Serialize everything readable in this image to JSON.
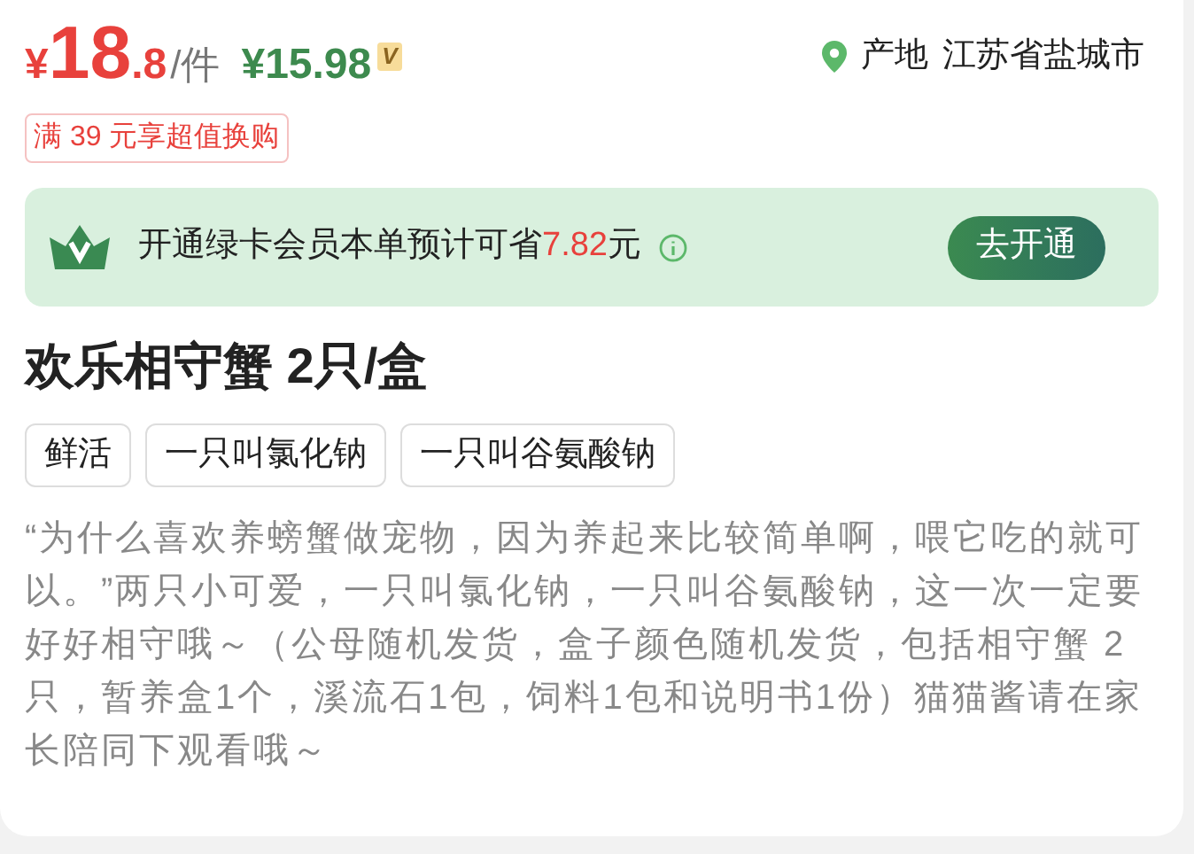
{
  "price": {
    "currency": "¥",
    "integer": "18",
    "decimal": ".8",
    "unit": "/件",
    "member_price": "¥15.98",
    "member_badge": "V"
  },
  "origin": {
    "label": "产地",
    "value": "江苏省盐城市"
  },
  "promo_tag": "满 39 元享超值换购",
  "membership_banner": {
    "text": "开通绿卡会员本单预计可省",
    "amount": "7.82",
    "suffix": "元",
    "button": "去开通"
  },
  "title": "欢乐相守蟹 2只/盒",
  "tags": [
    "鲜活",
    "一只叫氯化钠",
    "一只叫谷氨酸钠"
  ],
  "description": "“为什么喜欢养螃蟹做宠物，因为养起来比较简单啊，喂它吃的就可以。”两只小可爱，一只叫氯化钠，一只叫谷氨酸钠，这一次一定要好好相守哦～（公母随机发货，盒子颜色随机发货，包括相守蟹 2 只，暂养盒1个，溪流石1包，饲料1包和说明书1份）猫猫酱请在家长陪同下观看哦～"
}
